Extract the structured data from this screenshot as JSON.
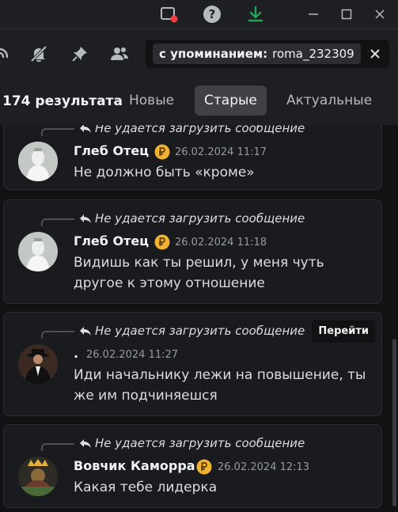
{
  "search": {
    "token_label": "с упоминанием:",
    "token_value": "roma_232309"
  },
  "results": {
    "count_label": "174 результата",
    "tabs": [
      {
        "label": "Новые",
        "active": false
      },
      {
        "label": "Старые",
        "active": true
      },
      {
        "label": "Актуальные",
        "active": false
      }
    ]
  },
  "messages": [
    {
      "reply_text": "Не удается загрузить сообщение",
      "author": "Глеб Отец",
      "timestamp": "26.02.2024 11:17",
      "text": "Не должно быть «кроме»"
    },
    {
      "reply_text": "Не удается загрузить сообщение",
      "author": "Глеб Отец",
      "timestamp": "26.02.2024 11:18",
      "text": "Видишь как ты решил, у меня чуть другое к этому отношение"
    },
    {
      "reply_text": "Не удается загрузить сообщение",
      "author": ".",
      "timestamp": "26.02.2024 11:27",
      "text": "Иди начальнику лежи на повышение, ты же им подчиняешся",
      "jump_label": "Перейти"
    },
    {
      "reply_text": "Не удается загрузить сообщение",
      "author": "Вовчик Каморра",
      "timestamp": "26.02.2024 12:13",
      "text": "Какая тебе лидерка"
    }
  ],
  "colors": {
    "accent_green": "#23a55a",
    "badge_orange": "#f0b232",
    "notification_red": "#f23f43"
  }
}
